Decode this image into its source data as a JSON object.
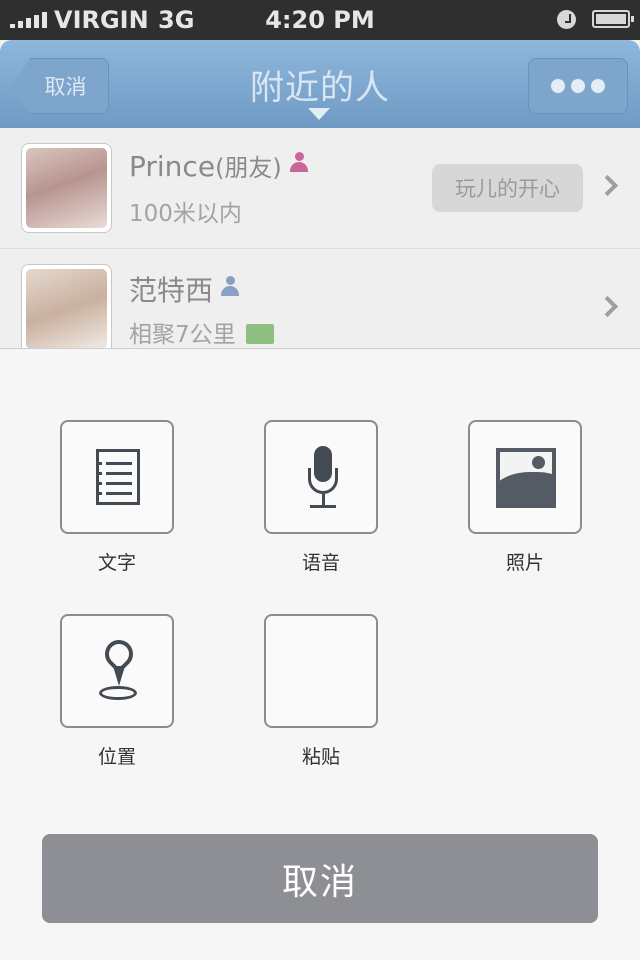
{
  "status_bar": {
    "carrier": "VIRGIN",
    "network": "3G",
    "time": "4:20 PM"
  },
  "nav": {
    "back_label": "取消",
    "title": "附近的人"
  },
  "list": [
    {
      "name": "Prince",
      "name_suffix": "(朋友)",
      "gender": "female",
      "distance": "100米以内",
      "status": "玩儿的开心"
    },
    {
      "name": "范特西",
      "name_suffix": "",
      "gender": "male",
      "distance": "相聚7公里",
      "status": ""
    }
  ],
  "colors": {
    "female_icon": "#c7679a",
    "male_icon": "#8aa0c2",
    "nav_blue": "#7ea6cd",
    "cancel_button": "#8d8f94"
  },
  "sheet": {
    "actions": [
      {
        "label": "文字",
        "icon": "text-icon"
      },
      {
        "label": "语音",
        "icon": "mic-icon"
      },
      {
        "label": "照片",
        "icon": "photo-icon"
      },
      {
        "label": "位置",
        "icon": "location-pin-icon"
      },
      {
        "label": "粘贴",
        "icon": ""
      }
    ],
    "cancel_label": "取消"
  }
}
